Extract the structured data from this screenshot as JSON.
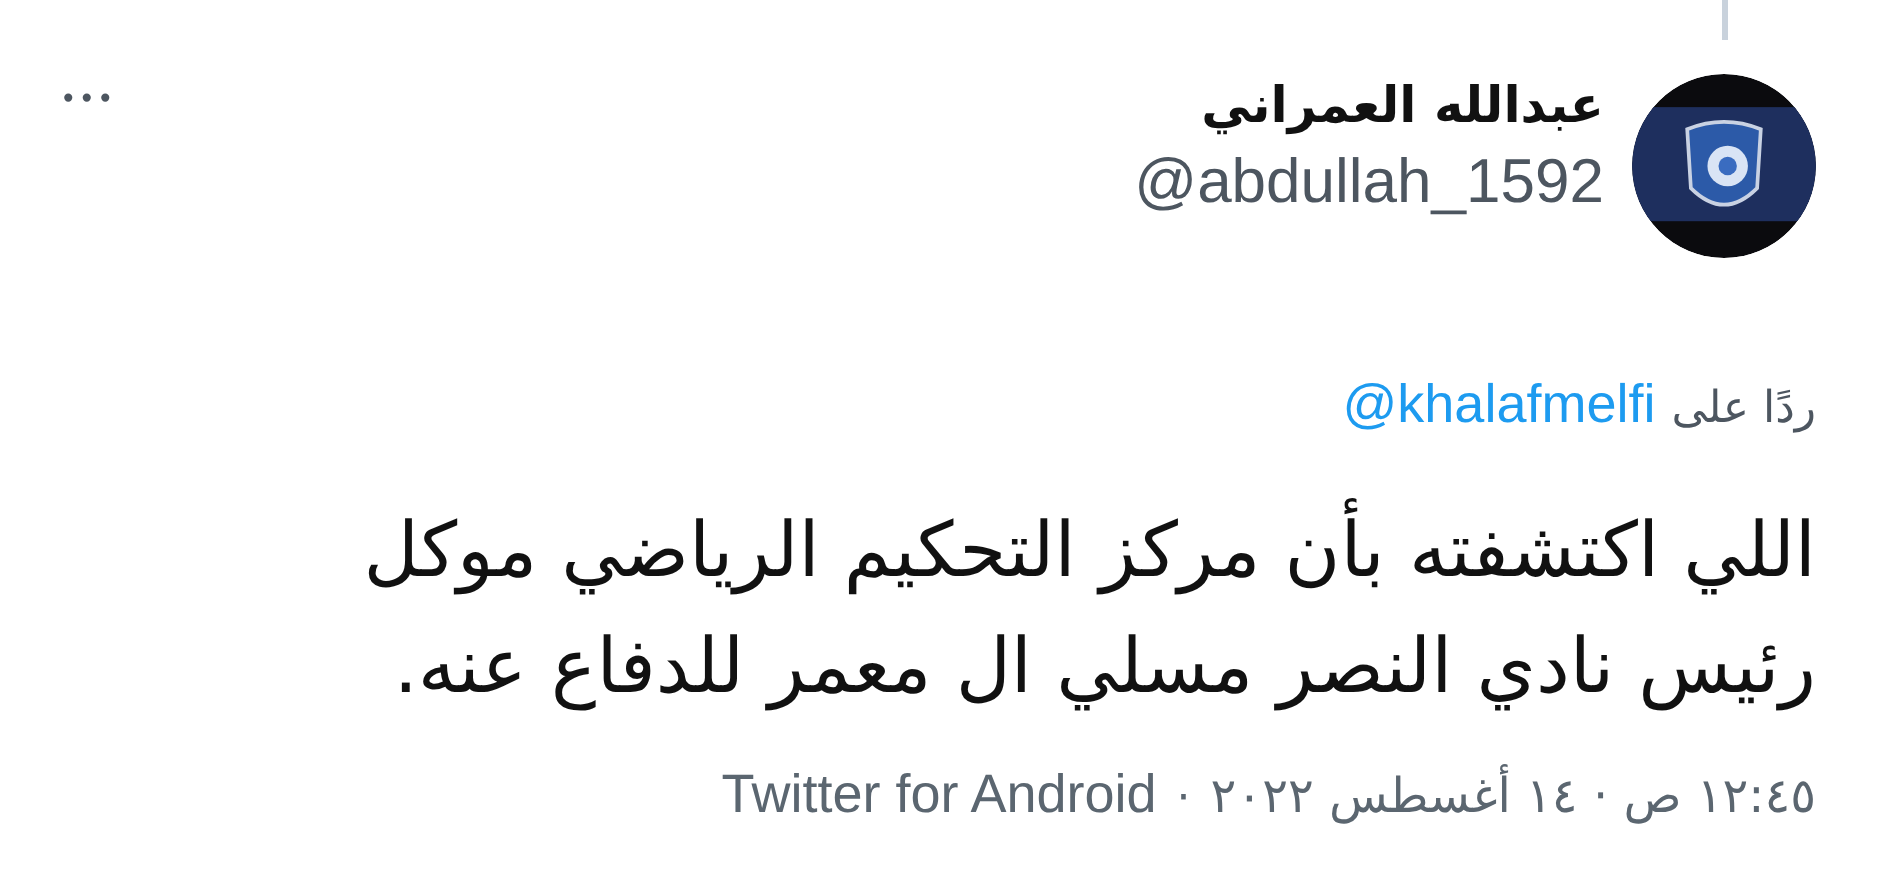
{
  "author": {
    "name": "عبدالله العمراني",
    "handle": "@abdullah_1592"
  },
  "more_button": {
    "label": "•••"
  },
  "reply_to": {
    "prefix": "ردًا على",
    "handle": "@khalafmelfi"
  },
  "tweet_text": "اللي اكتشفته بأن مركز التحكيم الرياضي موكل\nرئيس نادي النصر مسلي ال معمر للدفاع عنه.",
  "meta": {
    "timestamp": "١٢:٤٥ ص · ١٤ أغسطس ٢٠٢٢",
    "separator": "·",
    "source": "Twitter for Android"
  }
}
